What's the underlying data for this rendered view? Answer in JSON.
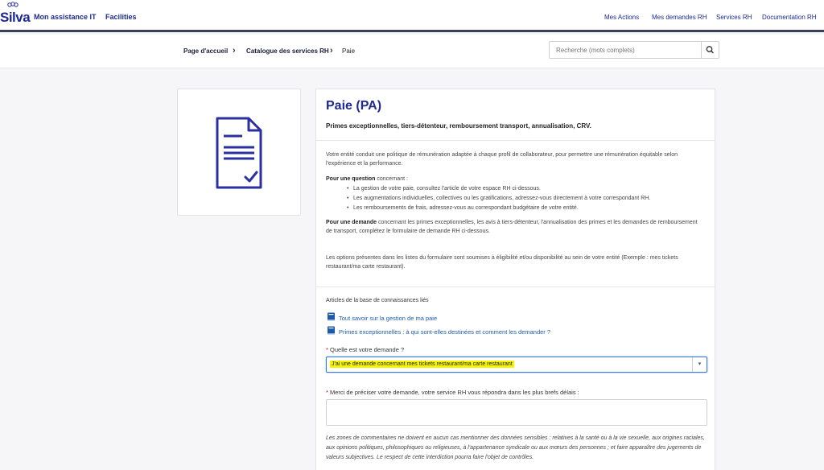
{
  "header": {
    "logo_text": "Silva",
    "nav_left": [
      "Mon assistance IT",
      "Facilities"
    ],
    "nav_right": [
      "Mes Actions",
      "Mes demandes RH",
      "Services RH",
      "Documentation RH"
    ]
  },
  "breadcrumb": {
    "items": [
      "Page d'accueil",
      "Catalogue des services RH",
      "Paie"
    ],
    "separator": "›"
  },
  "search": {
    "placeholder": "Recherche (mots complets)",
    "icon": "search-icon"
  },
  "item": {
    "icon": "document-check-icon",
    "title": "Paie (PA)",
    "subtitle": "Primes exceptionnelles, tiers-détenteur, remboursement transport, annualisation, CRV."
  },
  "description": {
    "intro": "Votre entité conduit une politique de rémunération adaptée à chaque profil de collaborateur, pour permettre une rémunération équitable selon l'expérience et la performance.",
    "question_strong": "Pour une question",
    "question_rest": " concernant :",
    "bullets": [
      "La gestion de votre paie, consultez l'article de votre espace RH ci-dessous.",
      "Les augmentations individuelles, collectives ou les gratifications, adressez-vous directement à votre correspondant RH.",
      "Les remboursements de frais, adressez-vous au correspondant budgétaire de votre entité."
    ],
    "demande_strong": "Pour une demande",
    "demande_rest": " concernant les primes exceptionnelles, les avis à tiers-détenteur, l'annualisation des primes et les demandes de remboursement de transport, complétez le formulaire de demande RH ci-dessous.",
    "options_note": "Les options présentes dans les listes du formulaire sont soumises à éligibilité et/ou disponibilité au sein de votre entité (Exemple : mes tickets restaurant/ma carte restaurant)."
  },
  "knowledge": {
    "title": "Articles de la base de connaissances liés",
    "links": [
      "Tout savoir sur la gestion de ma paie",
      "Primes exceptionnelles : à qui sont-elles destinées et comment les demander ?"
    ],
    "icon": "book-icon"
  },
  "form": {
    "required_mark": "*",
    "question_label": "Quelle est votre demande ?",
    "question_value": "J'ai une demande concernant mes tickets restaurant/ma carte restaurant",
    "details_label": "Merci de préciser votre demande, votre service RH vous répondra dans les plus brefs délais :",
    "details_value": "",
    "notice": "Les zones de commentaires ne doivent en aucun cas mentionner des données sensibles : relatives à la santé ou à la vie sexuelle, aux origines raciales, aux opinions politiques, philosophiques ou religieuses, à l'appartenance syndicale ou aux mœurs des personnes ; et faire apparaître des jugements de valeurs subjectives. Le respect de cette interdiction pourra faire l'objet de contrôles."
  },
  "colors": {
    "brand": "#1e2a8f",
    "link": "#1e5aa8",
    "highlight": "#f6f400",
    "required": "#d0021b"
  }
}
